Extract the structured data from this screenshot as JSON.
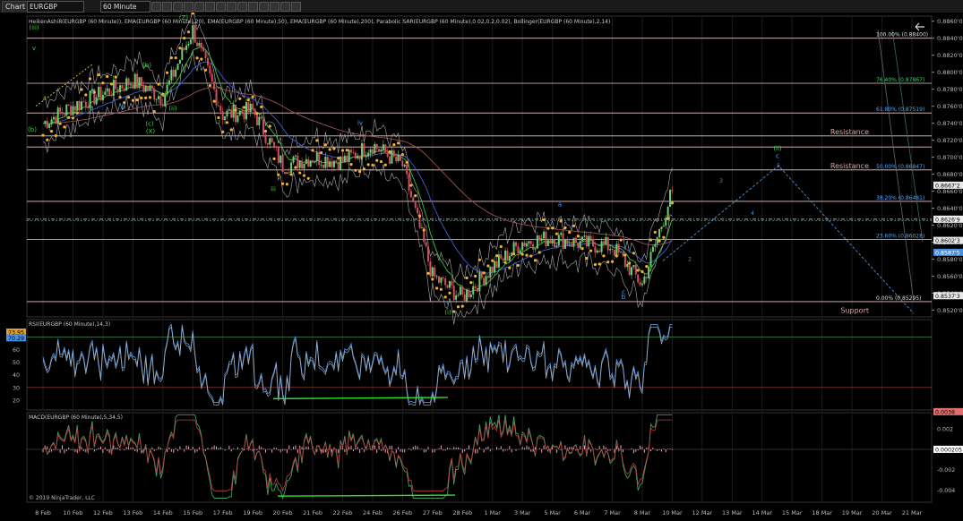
{
  "toolbar": {
    "chart_label": "Chart",
    "instrument": "EURGBP",
    "timeframe": "60 Minute"
  },
  "price_panel": {
    "indicator_title": "HeikenAshi8(EURGBP (60 Minute)), EMA(EURGBP (60 Minute),20), EMA(EURGBP (60 Minute),50), EMA(EURGBP (60 Minute),200), Parabolic SAR(EURGBP (60 Minute),0.02,0.2,0.02), Bollinger(EURGBP (60 Minute),2,14)",
    "price_ticks": [
      "0.8860'0",
      "0.8840'0",
      "0.8820'0",
      "0.8800'0",
      "0.8780'0",
      "0.8760'0",
      "0.8740'0",
      "0.8720'0",
      "0.8700'0",
      "0.8680'0",
      "0.8660'0",
      "0.8640'0",
      "0.8620'0",
      "0.8600'0",
      "0.8580'0",
      "0.8560'0",
      "0.8540'0",
      "0.8520'0"
    ],
    "price_tick_values": [
      0.886,
      0.884,
      0.882,
      0.88,
      0.878,
      0.876,
      0.874,
      0.872,
      0.87,
      0.868,
      0.866,
      0.864,
      0.862,
      0.86,
      0.858,
      0.856,
      0.854,
      0.852
    ],
    "fib_levels": [
      {
        "label": "100.00% (0.88400)",
        "price": 0.884,
        "color": "#dddddd"
      },
      {
        "label": "76.40% (0.87867)",
        "price": 0.8787,
        "color": "#3fcf6f"
      },
      {
        "label": "61.80% (0.87519)",
        "price": 0.8752,
        "color": "#4aa8ff"
      },
      {
        "label": "50.00% (0.86847)",
        "price": 0.8685,
        "color": "#4aa8ff"
      },
      {
        "label": "38.20% (0.86481)",
        "price": 0.8648,
        "color": "#4aa8ff"
      },
      {
        "label": "23.60% (0.86028)",
        "price": 0.8603,
        "color": "#4aa8ff"
      },
      {
        "label": "0.00% (0.85295)",
        "price": 0.853,
        "color": "#dddddd"
      }
    ],
    "sr_labels": [
      {
        "text": "Resistance",
        "price": 0.8725
      },
      {
        "text": "Resistance",
        "price": 0.8685
      },
      {
        "text": "Support",
        "price": 0.8525
      }
    ],
    "price_badges": [
      {
        "text": "0.8667'2",
        "price": 0.8667,
        "bg": "#e8e8e8",
        "fg": "#000"
      },
      {
        "text": "0.8626'9",
        "price": 0.8627,
        "bg": "#f0f0f0",
        "fg": "#000"
      },
      {
        "text": "0.8602'3",
        "price": 0.8602,
        "bg": "#e8e8e8",
        "fg": "#000"
      },
      {
        "text": "0.8587'5",
        "price": 0.8588,
        "bg": "#4a90e2",
        "fg": "#fff"
      },
      {
        "text": "0.8537'3",
        "price": 0.8537,
        "bg": "#e8e8e8",
        "fg": "#000"
      }
    ],
    "wave_labels": [
      {
        "text": "(iii)",
        "x": 38,
        "price": 0.885,
        "color": "#3fcf3f"
      },
      {
        "text": "v",
        "x": 38,
        "price": 0.8826,
        "color": "#3fcf3f"
      },
      {
        "text": "(b)",
        "x": 36,
        "price": 0.873,
        "color": "#3fcf3f"
      },
      {
        "text": "a",
        "x": 103,
        "price": 0.8776,
        "color": "#4aa8ff"
      },
      {
        "text": "b",
        "x": 138,
        "price": 0.8757,
        "color": "#4aa8ff"
      },
      {
        "text": "(b)",
        "x": 164,
        "price": 0.8806,
        "color": "#3fcf3f"
      },
      {
        "text": "(c)",
        "x": 167,
        "price": 0.8737,
        "color": "#3fcf3f"
      },
      {
        "text": "(X)",
        "x": 168,
        "price": 0.8728,
        "color": "#3fcf3f"
      },
      {
        "text": "(Y)",
        "x": 206,
        "price": 0.887,
        "color": "#3fcf3f"
      },
      {
        "text": "(Z)",
        "x": 205,
        "price": 0.8862,
        "color": "#3fcf3f"
      },
      {
        "text": "(ii)",
        "x": 193,
        "price": 0.8755,
        "color": "#3fcf3f"
      },
      {
        "text": "i",
        "x": 245,
        "price": 0.874,
        "color": "#3fcf3f"
      },
      {
        "text": "iii",
        "x": 305,
        "price": 0.866,
        "color": "#3fcf3f"
      },
      {
        "text": "iv",
        "x": 402,
        "price": 0.8738,
        "color": "#4aa8ff"
      },
      {
        "text": "v",
        "x": 500,
        "price": 0.8526,
        "color": "#4aa8ff"
      },
      {
        "text": "(i)",
        "x": 500,
        "price": 0.8515,
        "color": "#3fcf3f"
      },
      {
        "text": "a",
        "x": 625,
        "price": 0.8642,
        "color": "#4aa8ff"
      },
      {
        "text": "c",
        "x": 696,
        "price": 0.8539,
        "color": "#4aa8ff"
      },
      {
        "text": "b",
        "x": 696,
        "price": 0.8533,
        "color": "#4aa8ff"
      },
      {
        "text": "(ii)",
        "x": 868,
        "price": 0.8708,
        "color": "#3fcf3f"
      },
      {
        "text": "c",
        "x": 868,
        "price": 0.8699,
        "color": "#4aa8ff"
      }
    ],
    "projection_labels": [
      {
        "text": "2",
        "x": 770,
        "price": 0.8578
      },
      {
        "text": "3",
        "x": 805,
        "price": 0.867
      },
      {
        "text": "4",
        "x": 840,
        "price": 0.8632
      },
      {
        "text": "5",
        "x": 869,
        "price": 0.8688
      }
    ]
  },
  "rsi_panel": {
    "title": "RSI(EURGBP (60 Minute),14,3)",
    "ticks": [
      "70",
      "60",
      "50",
      "40",
      "30",
      "20"
    ],
    "tick_values": [
      70,
      60,
      50,
      40,
      30,
      20
    ],
    "levels": [
      70,
      30
    ],
    "badges": [
      {
        "text": "73.95",
        "value": 74,
        "bg": "#e0a030"
      },
      {
        "text": "70.29",
        "value": 69.5,
        "bg": "#4a90e2"
      }
    ]
  },
  "macd_panel": {
    "title": "MACD(EURGBP (60 Minute),5,34,5)",
    "ticks": [
      "0.002",
      "0",
      "-0.002",
      "-0.004"
    ],
    "tick_values": [
      0.002,
      0,
      -0.002,
      -0.004
    ],
    "badges": [
      {
        "text": "0.0038",
        "value": 0.0037,
        "bg": "#e07070"
      },
      {
        "text": "0.000205",
        "value": 0.0,
        "bg": "#ffffff"
      }
    ],
    "copyright": "© 2019 NinjaTrader, LLC"
  },
  "x_axis": {
    "labels": [
      "8 Feb",
      "10 Feb",
      "12 Feb",
      "13 Feb",
      "14 Feb",
      "15 Feb",
      "17 Feb",
      "19 Feb",
      "20 Feb",
      "21 Feb",
      "22 Feb",
      "24 Feb",
      "26 Feb",
      "27 Feb",
      "28 Feb",
      "1 Mar",
      "3 Mar",
      "5 Mar",
      "6 Mar",
      "7 Mar",
      "8 Mar",
      "10 Mar",
      "12 Mar",
      "13 Mar",
      "14 Mar",
      "15 Mar",
      "18 Mar",
      "19 Mar",
      "20 Mar",
      "21 Mar"
    ]
  },
  "chart_data": {
    "type": "line",
    "title": "EURGBP 60 Minute",
    "xlabel": "",
    "ylabel": "",
    "ylim": [
      0.8512,
      0.8866
    ],
    "series": [
      {
        "name": "EURGBP",
        "x": [
          "8 Feb",
          "10 Feb",
          "12 Feb",
          "13 Feb",
          "14 Feb",
          "15 Feb",
          "17 Feb",
          "19 Feb",
          "20 Feb",
          "21 Feb",
          "22 Feb",
          "24 Feb",
          "26 Feb",
          "27 Feb",
          "28 Feb",
          "1 Mar",
          "3 Mar",
          "5 Mar",
          "6 Mar",
          "7 Mar",
          "8 Mar",
          "10 Mar"
        ],
        "values": [
          0.874,
          0.876,
          0.8775,
          0.879,
          0.877,
          0.885,
          0.875,
          0.8755,
          0.869,
          0.87,
          0.8695,
          0.8715,
          0.869,
          0.856,
          0.8535,
          0.857,
          0.86,
          0.8605,
          0.8598,
          0.8595,
          0.855,
          0.866
        ]
      }
    ]
  }
}
